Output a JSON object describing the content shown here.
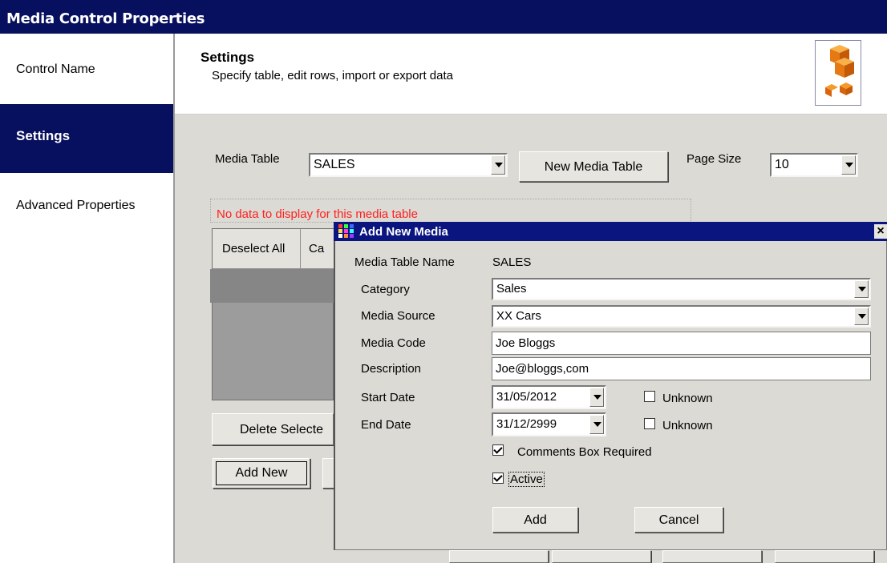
{
  "window": {
    "title": "Media Control Properties"
  },
  "sidebar": {
    "items": [
      {
        "label": "Control Name"
      },
      {
        "label": "Settings"
      },
      {
        "label": "Advanced Properties"
      }
    ]
  },
  "header": {
    "title": "Settings",
    "subtitle": "Specify table, edit rows, import or export data"
  },
  "settings": {
    "media_table_label": "Media Table",
    "media_table_value": "SALES",
    "new_media_table_button": "New Media Table",
    "page_size_label": "Page Size",
    "page_size_value": "10",
    "no_data_message": "No data to display for this media table",
    "grid_headers": [
      "Deselect All",
      "Ca"
    ],
    "delete_button": "Delete Selecte",
    "add_new_button": "Add New"
  },
  "dialog": {
    "title": "Add New Media",
    "close": "×",
    "table_name_label": "Media Table Name",
    "table_name_value": "SALES",
    "category_label": "Category",
    "category_value": "Sales",
    "media_source_label": "Media Source",
    "media_source_value": "XX Cars",
    "media_code_label": "Media Code",
    "media_code_value": "Joe Bloggs",
    "description_label": "Description",
    "description_value": "Joe@bloggs,com",
    "start_date_label": "Start Date",
    "start_date_value": "31/05/2012",
    "start_unknown_label": "Unknown",
    "start_unknown_checked": false,
    "end_date_label": "End Date",
    "end_date_value": "31/12/2999",
    "end_unknown_label": "Unknown",
    "end_unknown_checked": false,
    "comments_label": "Comments Box Required",
    "comments_checked": true,
    "active_label": "Active",
    "active_checked": true,
    "add_button": "Add",
    "cancel_button": "Cancel"
  },
  "colors": {
    "title_bar": "#07105e",
    "panel": "#dcdad4",
    "error_text": "#ff2020"
  }
}
